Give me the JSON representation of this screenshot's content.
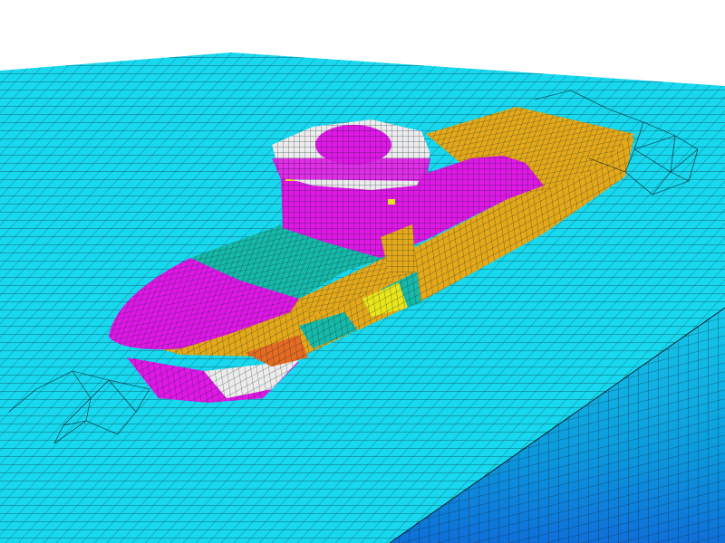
{
  "scene": {
    "subject": "",
    "colors": {
      "background": "#ffffff",
      "water_top": "#17d8ee",
      "water_side": "#0a9fdc",
      "water_side_dark": "#0f6fd8",
      "mesh_line": "#0b1e2a",
      "magenta": "#df18e6",
      "gold": "#e4a91a",
      "teal": "#17b9a9",
      "white_patch": "#ececec",
      "orange": "#e56b22",
      "yellow": "#e8e51a"
    },
    "parts": [
      "ocean-surface",
      "ocean-side-wall",
      "hull",
      "deck",
      "superstructure",
      "radar-dome",
      "wake-triangulation"
    ]
  }
}
